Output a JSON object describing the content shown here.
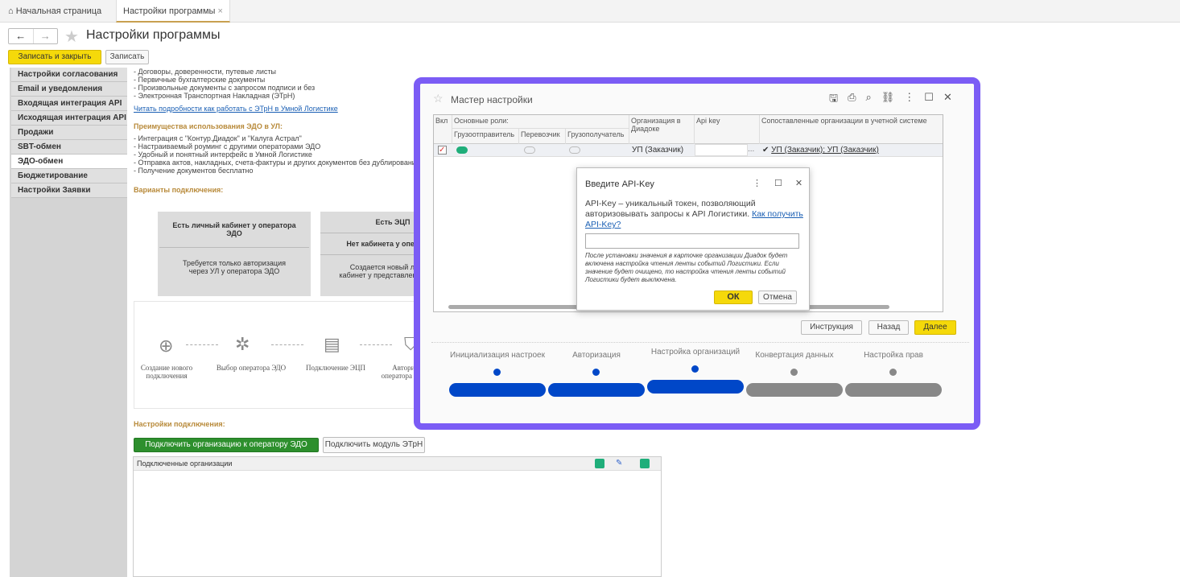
{
  "tabs": {
    "home": "Начальная страница",
    "settings": "Настройки программы",
    "close": "×"
  },
  "page": {
    "title": "Настройки программы",
    "save_close": "Записать и закрыть",
    "save": "Записать"
  },
  "sidebar": {
    "items": [
      "Настройки согласования",
      "Email и уведомления",
      "Входящая интеграция API",
      "Исходящая интеграция API",
      "Продажи",
      "SBT-обмен",
      "ЭДО-обмен",
      "Бюджетирование",
      "Настройки Заявки"
    ]
  },
  "content": {
    "docs": [
      "- Договоры, доверенности, путевые листы",
      "- Первичные бухгалтерские документы",
      "- Произвольные документы с запросом подписи и без",
      "- Электронная Транспортная Накладная (ЭТрН)"
    ],
    "link": "Читать подробности как работать с ЭТрН в Умной Логистике",
    "adv_title": "Преимущества использования ЭДО в УЛ:",
    "adv": [
      "- Интеграция с \"Контур.Диадок\" и \"Калуга Астрал\"",
      "- Настраиваемый роуминг с другими операторами ЭДО",
      "- Удобный и понятный интерфейс в Умной Логистике",
      "- Отправка актов, накладных, счета-фактуры и других документов без дублирования",
      "- Получение документов бесплатно"
    ],
    "variants_title": "Варианты подключения:",
    "card1": {
      "title": "Есть личный кабинет у оператора ЭДО",
      "text": "Требуется только авторизация через УЛ у оператора ЭДО"
    },
    "card2": {
      "title": "Есть ЭЦП",
      "subtitle": "Нет кабинета у оператора",
      "text": "Создается новый личный кабинет у представленных в УЛ"
    },
    "steps": [
      "Создание нового подключения",
      "Выбор оператора ЭДО",
      "Подключение ЭЦП",
      "Авторизация оператора из Умной"
    ],
    "conn_title": "Настройки подключения:",
    "connect_btn": "Подключить организацию к оператору ЭДО",
    "module_btn": "Подключить модуль ЭТрН",
    "orgs_header": "Подключенные организации"
  },
  "wizard": {
    "title": "Мастер настройки",
    "cols": {
      "on": "Вкл",
      "roles": "Основные роли:",
      "shipper": "Грузоотправитель",
      "carrier": "Перевозчик",
      "consignee": "Грузополучатель",
      "org": "Организация в Диадоке",
      "api": "Api key",
      "mapped": "Сопоставленные организации в учетной системе"
    },
    "row": {
      "checked": true,
      "org": "УП (Заказчик)",
      "ellipsis": "...",
      "mapped": "УП (Заказчик); УП (Заказчик)"
    },
    "buttons": {
      "instr": "Инструкция",
      "back": "Назад",
      "next": "Далее"
    },
    "steps": [
      {
        "label": "Инициализация настроек",
        "done": true
      },
      {
        "label": "Авторизация",
        "done": true
      },
      {
        "label": "Настройка организаций",
        "done": true,
        "current": true
      },
      {
        "label": "Конвертация данных",
        "done": false
      },
      {
        "label": "Настройка прав",
        "done": false
      }
    ]
  },
  "apikey": {
    "title": "Введите API-Key",
    "desc": "API-Key – уникальный токен, позволяющий авторизовывать запросы к API Логистики.",
    "link": "Как получить API-Key?",
    "value": "",
    "note": "После установки значения в карточке организации Диадок будет включена настройка чтения ленты событий Логистики. Если значение будет очищено, то настройка чтения ленты событий Логистики будет выключена.",
    "ok": "ОК",
    "cancel": "Отмена"
  },
  "colors": {
    "accent": "#7b5cf5",
    "yellow": "#f5d90a",
    "green": "#2d8f2d",
    "stepDone": "#0047c8",
    "stepTodo": "#888888"
  }
}
